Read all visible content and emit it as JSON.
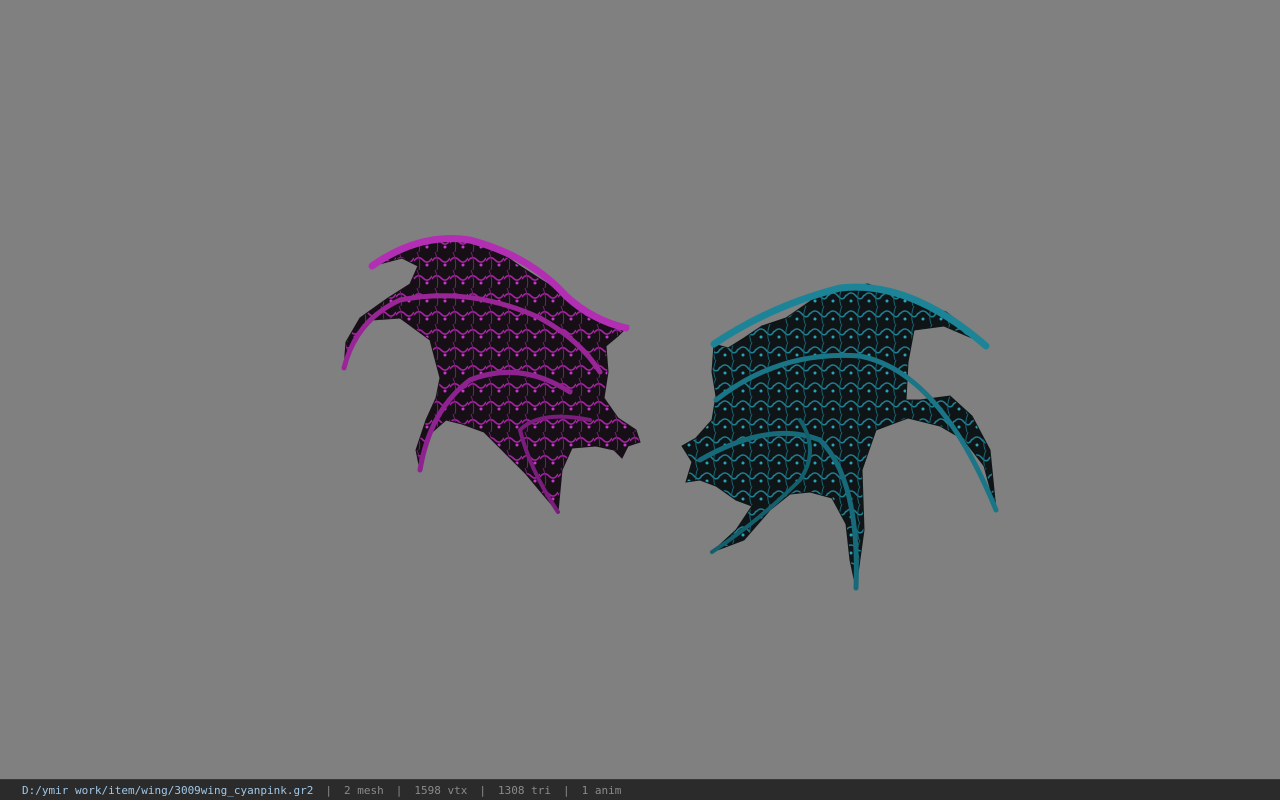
{
  "viewport": {
    "background": "#808080",
    "model": {
      "wing_left_color": "#c23ac6",
      "wing_right_color": "#1f8fa3",
      "wing_base_color": "#141414"
    }
  },
  "status_bar": {
    "path": "D:/ymir work/item/wing/3009wing_cyanpink.gr2",
    "separator": "|",
    "mesh": "2 mesh",
    "vertices": "1598 vtx",
    "triangles": "1308 tri",
    "animations": "1 anim"
  }
}
